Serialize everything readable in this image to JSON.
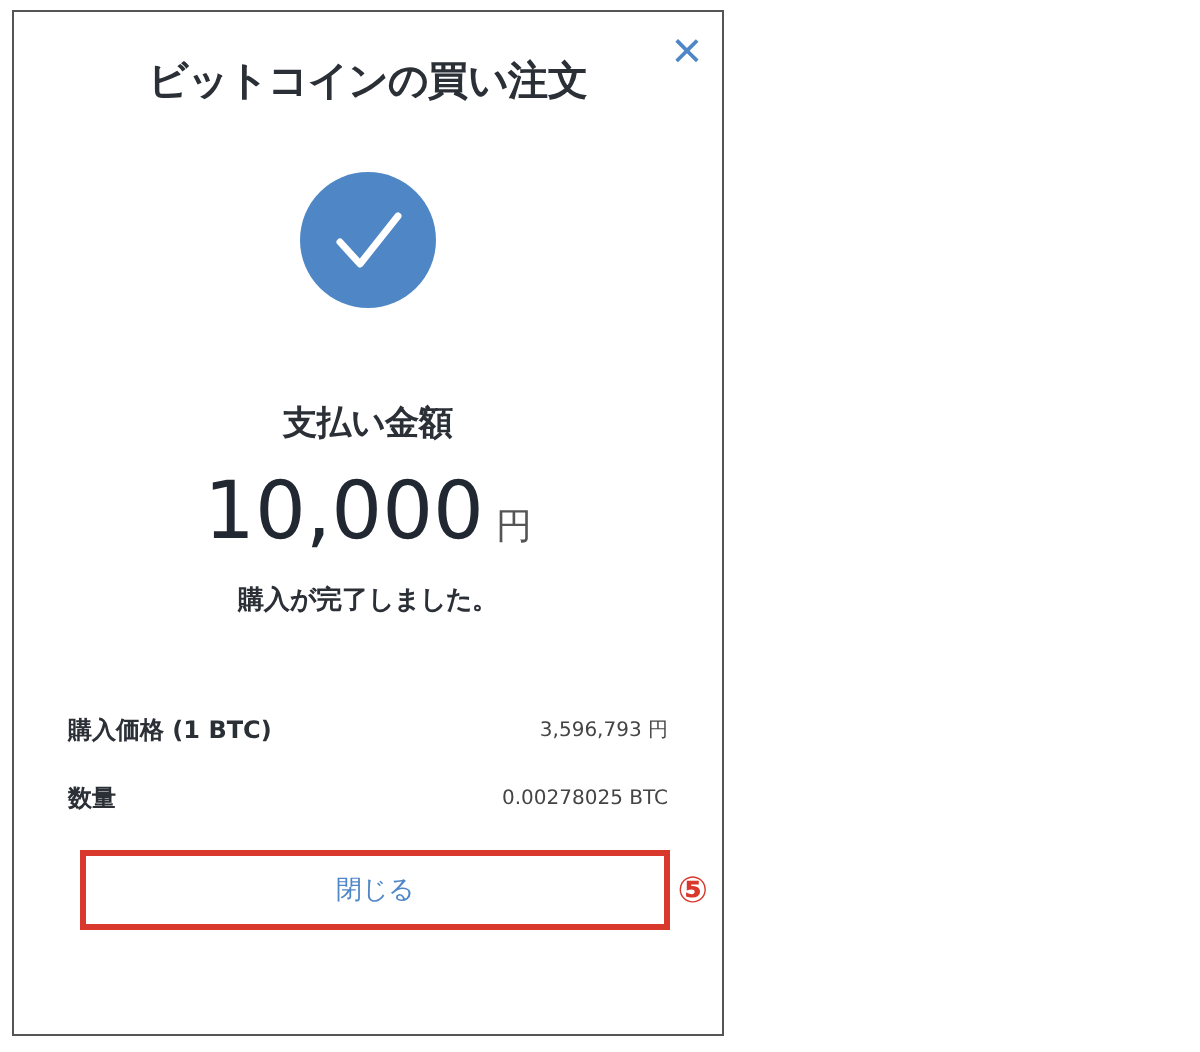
{
  "dialog": {
    "title": "ビットコインの買い注文",
    "close": "×"
  },
  "payment": {
    "label": "支払い金額",
    "amount": "10,000",
    "unit": "円",
    "message": "購入が完了しました。"
  },
  "details": [
    {
      "label": "購入価格 (1 BTC)",
      "value": "3,596,793 円"
    },
    {
      "label": "数量",
      "value": "0.00278025 BTC"
    }
  ],
  "button": {
    "label": "閉じる",
    "highlighted": true
  },
  "annotation": {
    "label": "⑤"
  }
}
